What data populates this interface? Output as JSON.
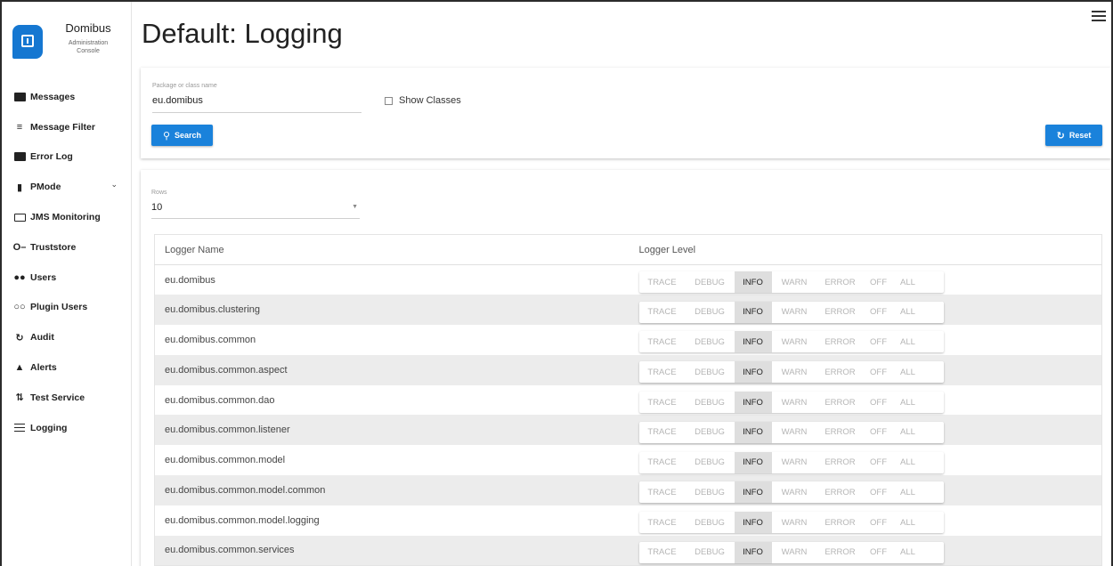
{
  "brand": {
    "title": "Domibus",
    "subtitle_line1": "Administration",
    "subtitle_line2": "Console"
  },
  "nav": {
    "items": [
      {
        "label": "Messages",
        "icon": "message-icon"
      },
      {
        "label": "Message Filter",
        "icon": "filter-icon"
      },
      {
        "label": "Error Log",
        "icon": "error-log-icon"
      },
      {
        "label": "PMode",
        "icon": "document-icon",
        "expandable": true
      },
      {
        "label": "JMS Monitoring",
        "icon": "monitor-icon"
      },
      {
        "label": "Truststore",
        "icon": "key-icon"
      },
      {
        "label": "Users",
        "icon": "users-icon"
      },
      {
        "label": "Plugin Users",
        "icon": "plugin-users-icon"
      },
      {
        "label": "Audit",
        "icon": "audit-icon"
      },
      {
        "label": "Alerts",
        "icon": "alert-bell-icon"
      },
      {
        "label": "Test Service",
        "icon": "swap-arrows-icon"
      },
      {
        "label": "Logging",
        "icon": "list-icon"
      }
    ]
  },
  "page": {
    "title": "Default: Logging"
  },
  "filter": {
    "package_label": "Package or class name",
    "package_value": "eu.domibus",
    "show_classes_label": "Show Classes",
    "show_classes_checked": false,
    "search_label": "Search",
    "reset_label": "Reset"
  },
  "rows": {
    "label": "Rows",
    "value": "10"
  },
  "table": {
    "columns": [
      "Logger Name",
      "Logger Level"
    ],
    "levels": [
      "TRACE",
      "DEBUG",
      "INFO",
      "WARN",
      "ERROR",
      "OFF",
      "ALL"
    ],
    "rows": [
      {
        "name": "eu.domibus",
        "level": "INFO"
      },
      {
        "name": "eu.domibus.clustering",
        "level": "INFO"
      },
      {
        "name": "eu.domibus.common",
        "level": "INFO"
      },
      {
        "name": "eu.domibus.common.aspect",
        "level": "INFO"
      },
      {
        "name": "eu.domibus.common.dao",
        "level": "INFO"
      },
      {
        "name": "eu.domibus.common.listener",
        "level": "INFO"
      },
      {
        "name": "eu.domibus.common.model",
        "level": "INFO"
      },
      {
        "name": "eu.domibus.common.model.common",
        "level": "INFO"
      },
      {
        "name": "eu.domibus.common.model.logging",
        "level": "INFO"
      },
      {
        "name": "eu.domibus.common.services",
        "level": "INFO"
      }
    ]
  },
  "colors": {
    "accent": "#1a82db",
    "brand": "#1577d1",
    "row_alt": "#ececec",
    "active_level": "#dedede"
  }
}
